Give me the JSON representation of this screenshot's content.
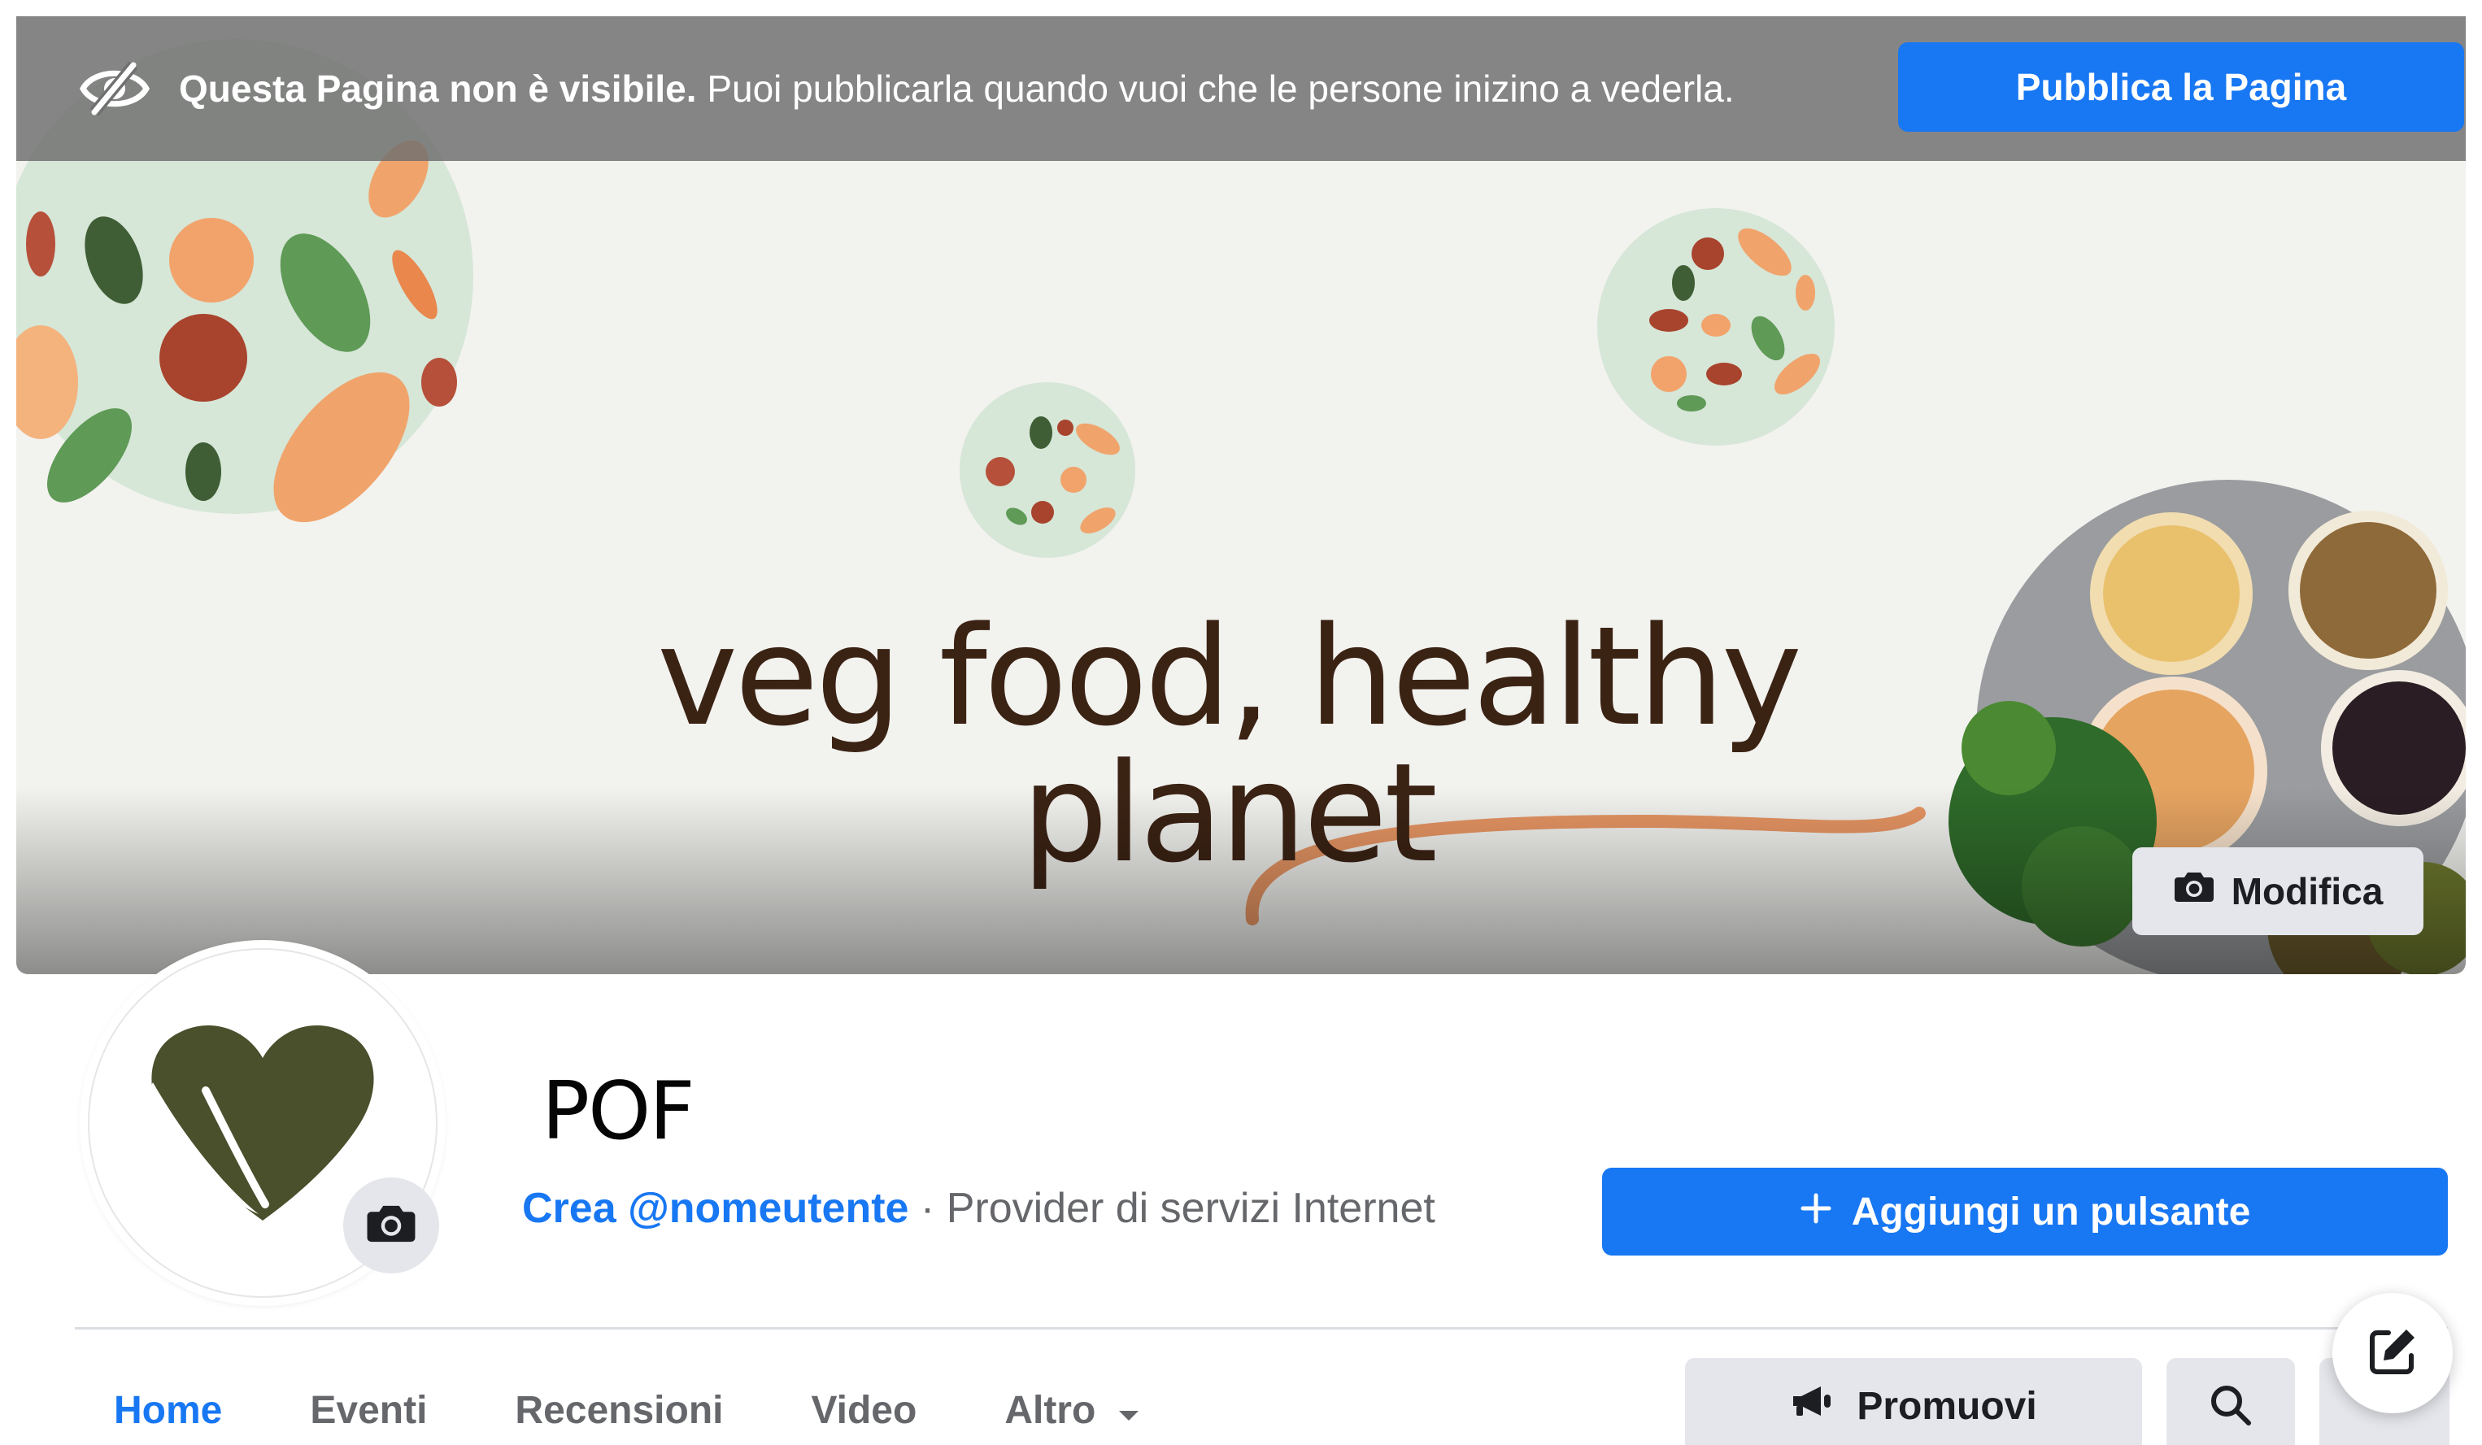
{
  "banner": {
    "title": "Questa Pagina non è visibile.",
    "message": "Puoi pubblicarla quando vuoi che le persone inizino a vederla.",
    "publish_button": "Pubblica la Pagina",
    "icon": "eye-slash-icon"
  },
  "cover": {
    "slogan": "veg food, healthy planet",
    "edit_button": "Modifica",
    "edit_icon": "camera-icon"
  },
  "profile": {
    "name": "POF",
    "username_link": "Crea @nomeutente",
    "separator": " · ",
    "category": "Provider di servizi Internet",
    "avatar_camera_icon": "camera-icon",
    "add_button": "Aggiungi un pulsante",
    "add_icon": "plus-icon"
  },
  "tabs": [
    {
      "label": "Home",
      "active": true
    },
    {
      "label": "Eventi",
      "active": false
    },
    {
      "label": "Recensioni",
      "active": false
    },
    {
      "label": "Video",
      "active": false
    },
    {
      "label": "Altro",
      "active": false
    }
  ],
  "actions": {
    "promote_button": "Promuovi",
    "promote_icon": "megaphone-icon",
    "search_icon": "search-icon",
    "compose_icon": "compose-icon"
  },
  "colors": {
    "accent": "#1877f2",
    "banner_bg": "#707070",
    "button_gray": "#e4e6eb",
    "logo_green": "#4a4f2c",
    "slogan_brown": "#3b2314"
  }
}
